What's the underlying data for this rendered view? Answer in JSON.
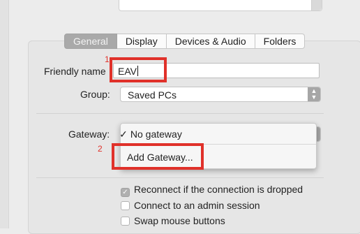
{
  "tabs": [
    "General",
    "Display",
    "Devices & Audio",
    "Folders"
  ],
  "friendly_name": {
    "label": "Friendly name",
    "value": "EAV",
    "step": "1"
  },
  "group": {
    "label": "Group:",
    "value": "Saved PCs"
  },
  "gateway": {
    "label": "Gateway:",
    "step": "2",
    "menu": {
      "selected": "No gateway",
      "check": "✓",
      "add": "Add Gateway..."
    }
  },
  "options": [
    {
      "label": "Reconnect if the connection is dropped",
      "checked": true
    },
    {
      "label": "Connect to an admin session",
      "checked": false
    },
    {
      "label": "Swap mouse buttons",
      "checked": false
    }
  ],
  "icons": {
    "stepper": "updown-chevron-icon",
    "check": "checkmark-icon"
  },
  "colors": {
    "highlight": "#e0312a",
    "active_tab": "#a9a9a9"
  }
}
